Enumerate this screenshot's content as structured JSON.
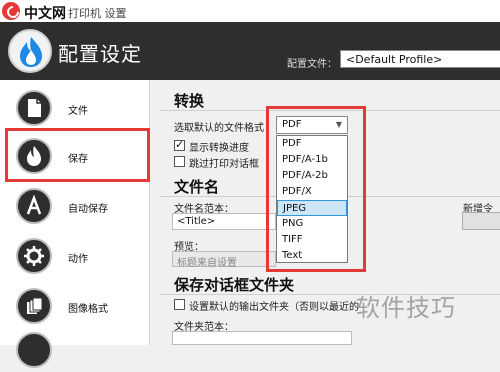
{
  "titlebar": {
    "site_name": "中文网",
    "title": "打印机 设置"
  },
  "header": {
    "title": "配置设定",
    "profile_label": "配置文件：",
    "profile_value": "<Default Profile>"
  },
  "sidebar": {
    "items": [
      {
        "label": "文件",
        "icon": "document-icon"
      },
      {
        "label": "保存",
        "icon": "flame-icon",
        "selected": true
      },
      {
        "label": "自动保存",
        "icon": "auto-save-icon"
      },
      {
        "label": "动作",
        "icon": "gear-icon"
      },
      {
        "label": "图像格式",
        "icon": "image-format-icon"
      }
    ]
  },
  "convert": {
    "title": "转换",
    "format_label": "选取默认的文件格式",
    "format_value": "PDF",
    "show_progress_label": "显示转换进度",
    "show_progress_checked": true,
    "skip_dialog_label": "跳过打印对话框（",
    "skip_dialog_checked": false
  },
  "format_options": [
    "PDF",
    "PDF/A-1b",
    "PDF/A-2b",
    "PDF/X",
    "JPEG",
    "PNG",
    "TIFF",
    "Text"
  ],
  "format_selected": "JPEG",
  "filename": {
    "title": "文件名",
    "template_label": "文件名范本：",
    "template_value": "<Title>",
    "preview_label": "预览：",
    "preview_value": "标题来自设置",
    "token_label": "新增令牌"
  },
  "save_dialog": {
    "title": "保存对话框文件夹",
    "default_folder_label": "设置默认的输出文件夹（否则以最近的",
    "default_folder_checked": false,
    "folder_template_label": "文件夹范本："
  },
  "watermark": "软件技巧",
  "colors": {
    "highlight": "#e53935",
    "header_bg": "#2e2e2e",
    "selection": "#cde6f7"
  }
}
